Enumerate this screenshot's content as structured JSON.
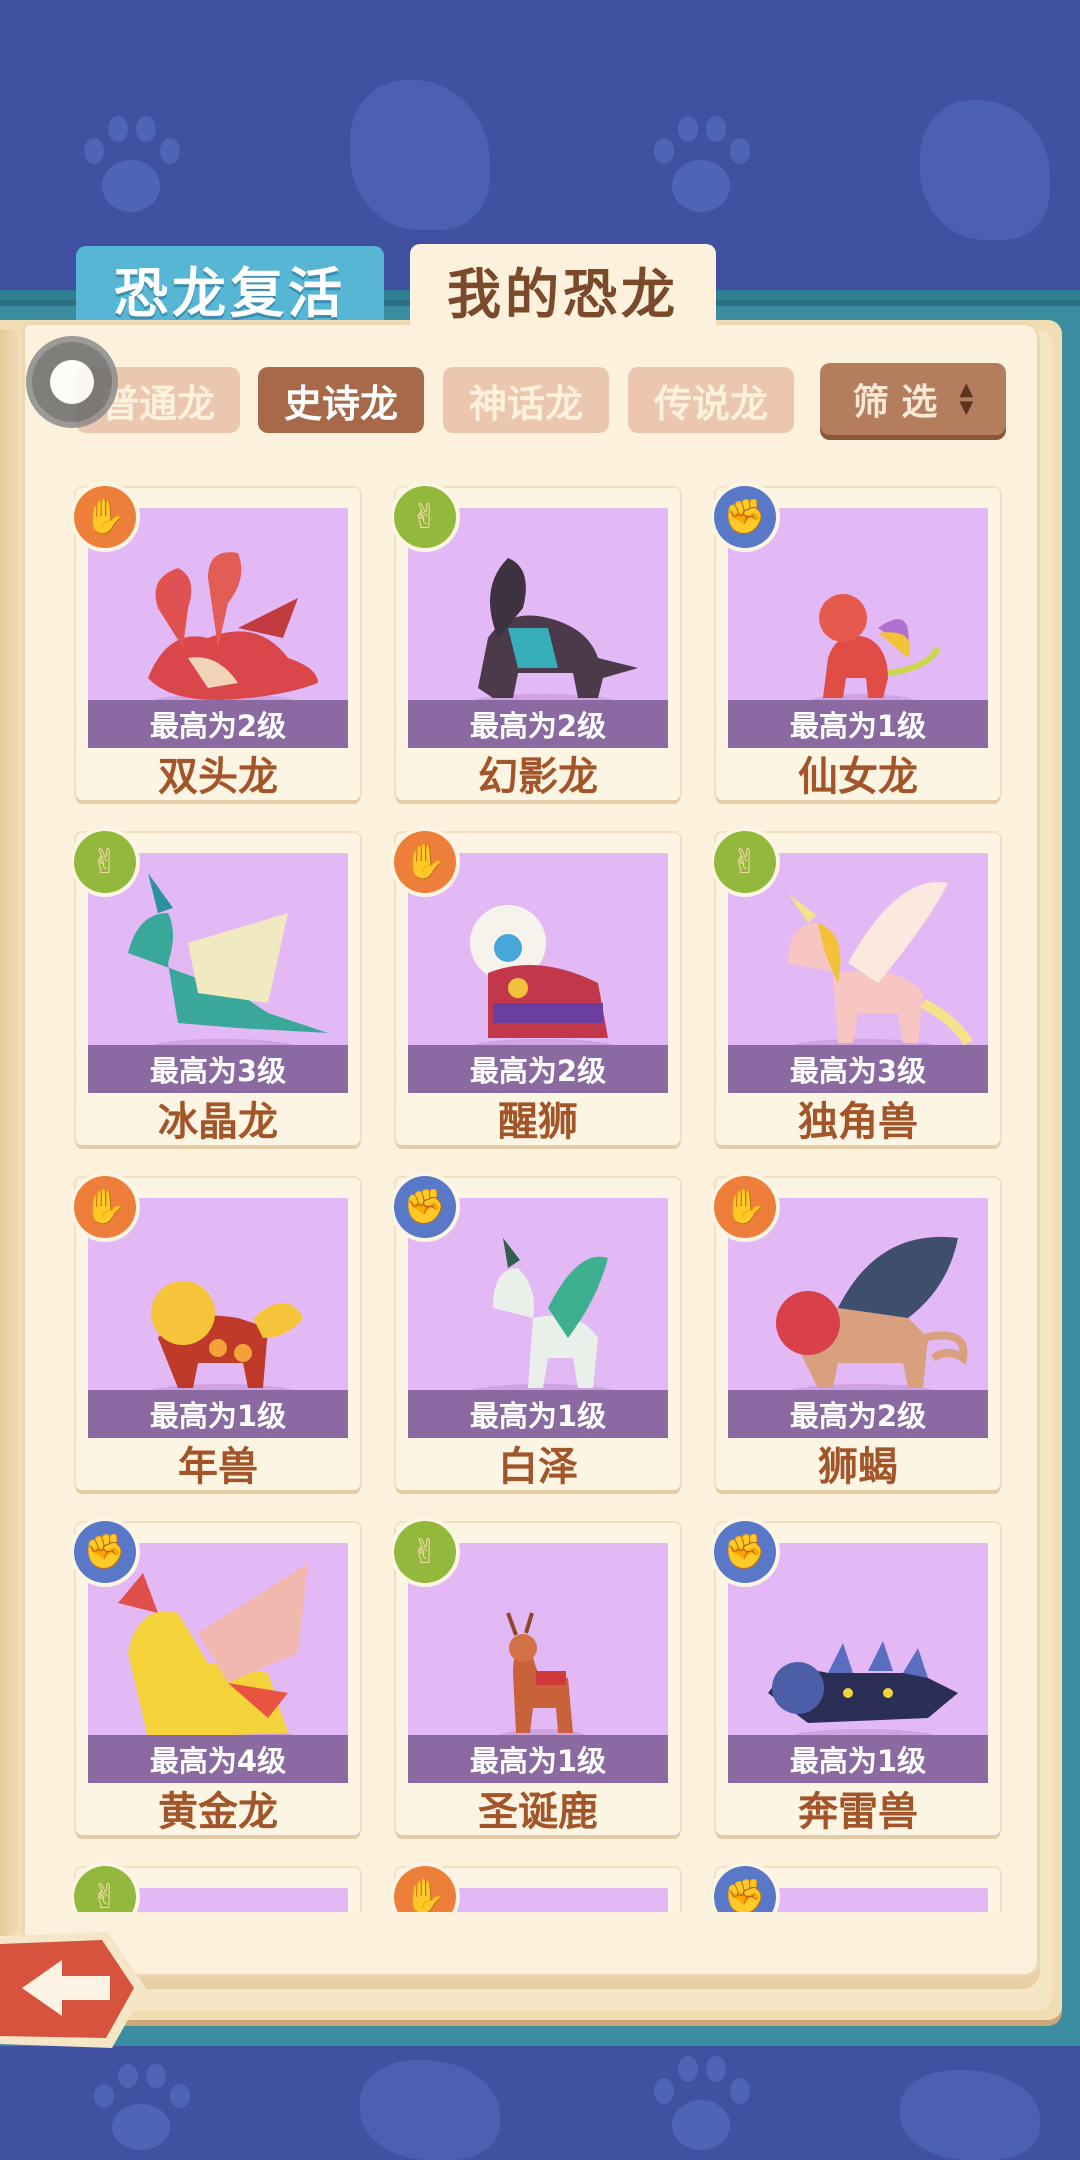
{
  "tabs": {
    "revive": "恐龙复活",
    "mine": "我的恐龙"
  },
  "filters": [
    {
      "label": "普通龙",
      "active": false
    },
    {
      "label": "史诗龙",
      "active": true
    },
    {
      "label": "神话龙",
      "active": false
    },
    {
      "label": "传说龙",
      "active": false
    }
  ],
  "filter_button": {
    "label": "筛 选",
    "arrow_up": "▲",
    "arrow_down": "▼"
  },
  "badge_icons": {
    "orange": "✋",
    "green": "✌",
    "blue": "✊"
  },
  "colors": {
    "orange": "#ee7f3a",
    "green": "#92b93c",
    "blue": "#5a78c8",
    "card_bg": "#e2b9f5",
    "active_filter": "#a8694a"
  },
  "cards": [
    {
      "name": "双头龙",
      "level": "最高为2级",
      "badge": "orange"
    },
    {
      "name": "幻影龙",
      "level": "最高为2级",
      "badge": "green"
    },
    {
      "name": "仙女龙",
      "level": "最高为1级",
      "badge": "blue"
    },
    {
      "name": "冰晶龙",
      "level": "最高为3级",
      "badge": "green"
    },
    {
      "name": "醒狮",
      "level": "最高为2级",
      "badge": "orange"
    },
    {
      "name": "独角兽",
      "level": "最高为3级",
      "badge": "green"
    },
    {
      "name": "年兽",
      "level": "最高为1级",
      "badge": "orange"
    },
    {
      "name": "白泽",
      "level": "最高为1级",
      "badge": "blue"
    },
    {
      "name": "狮蝎",
      "level": "最高为2级",
      "badge": "orange"
    },
    {
      "name": "黄金龙",
      "level": "最高为4级",
      "badge": "blue"
    },
    {
      "name": "圣诞鹿",
      "level": "最高为1级",
      "badge": "green"
    },
    {
      "name": "奔雷兽",
      "level": "最高为1级",
      "badge": "blue"
    },
    {
      "name": "",
      "level": "",
      "badge": "green"
    },
    {
      "name": "",
      "level": "",
      "badge": "orange"
    },
    {
      "name": "",
      "level": "",
      "badge": "blue"
    }
  ],
  "back_icon": "back-arrow-icon"
}
